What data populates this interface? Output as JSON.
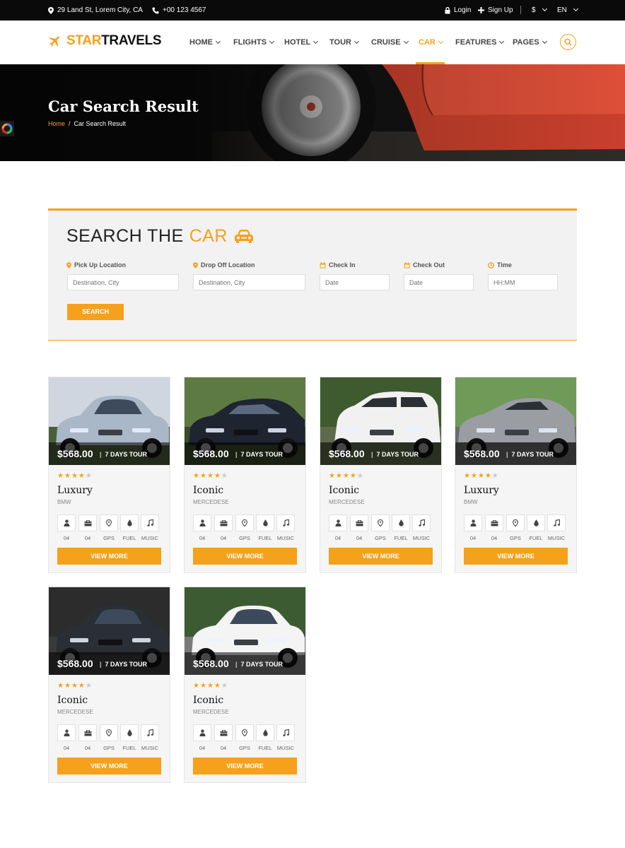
{
  "topbar": {
    "address": "29 Land St, Lorem City, CA",
    "phone": "+00 123 4567",
    "login": "Login",
    "signup": "Sign Up",
    "currency": "$",
    "language": "EN"
  },
  "brand": {
    "logo_part1": "STAR",
    "logo_part2": "TRAVELS",
    "accent": "#f5a11b"
  },
  "nav": [
    {
      "label": "HOME",
      "active": false
    },
    {
      "label": "FLIGHTS",
      "active": false
    },
    {
      "label": "HOTEL",
      "active": false
    },
    {
      "label": "TOUR",
      "active": false
    },
    {
      "label": "CRUISE",
      "active": false
    },
    {
      "label": "CAR",
      "active": true
    },
    {
      "label": "FEATURES",
      "active": false
    },
    {
      "label": "PAGES",
      "active": false
    }
  ],
  "hero": {
    "title": "Car Search Result",
    "breadcrumb_home": "Home",
    "breadcrumb_current": "Car Search Result"
  },
  "search": {
    "title_main": "SEARCH THE",
    "title_accent": "CAR",
    "fields": [
      {
        "label": "Pick Up Location",
        "icon": "map-pin-icon",
        "placeholder": "Destination, City"
      },
      {
        "label": "Drop Off Location",
        "icon": "map-pin-icon",
        "placeholder": "Destination, City"
      },
      {
        "label": "Check In",
        "icon": "calendar-icon",
        "placeholder": "Date"
      },
      {
        "label": "Check Out",
        "icon": "calendar-icon",
        "placeholder": "Date"
      },
      {
        "label": "Time",
        "icon": "clock-icon",
        "placeholder": "HH:MM"
      }
    ],
    "button": "SEARCH"
  },
  "cards": [
    {
      "price": "$568.00",
      "tour": "7 DAYS TOUR",
      "rating": 4,
      "name": "Luxury",
      "brand": "BMW"
    },
    {
      "price": "$568.00",
      "tour": "7 DAYS TOUR",
      "rating": 4,
      "name": "Iconic",
      "brand": "MERCEDESE"
    },
    {
      "price": "$568.00",
      "tour": "7 DAYS TOUR",
      "rating": 4,
      "name": "Iconic",
      "brand": "MERCEDESE"
    },
    {
      "price": "$568.00",
      "tour": "7 DAYS TOUR",
      "rating": 4,
      "name": "Luxury",
      "brand": "BMW"
    },
    {
      "price": "$568.00",
      "tour": "7 DAYS TOUR",
      "rating": 4,
      "name": "Iconic",
      "brand": "MERCEDESE"
    },
    {
      "price": "$568.00",
      "tour": "7 DAYS TOUR",
      "rating": 4,
      "name": "Iconic",
      "brand": "MERCEDESE"
    }
  ],
  "card_features": [
    {
      "icon": "user-icon",
      "label": "04"
    },
    {
      "icon": "briefcase-icon",
      "label": "04"
    },
    {
      "icon": "map-pin-icon",
      "label": "GPS"
    },
    {
      "icon": "fuel-drop-icon",
      "label": "FUEL"
    },
    {
      "icon": "music-icon",
      "label": "MUSIC"
    }
  ],
  "card_button": "VIEW MORE"
}
